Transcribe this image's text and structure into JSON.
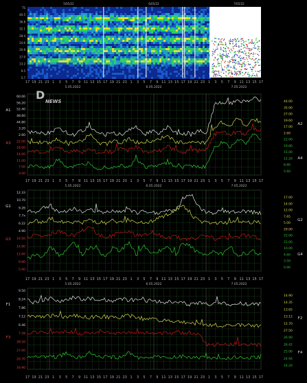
{
  "watermark": {
    "letter": "D",
    "word": "NEWS"
  },
  "spectrogram": {
    "type": "heatmap",
    "top_dates": [
      "5/05/22",
      "6/05/22",
      "7/05/22"
    ],
    "y_ticks": [
      "TS",
      "40.5",
      "36.8",
      "32.1",
      "28.4",
      "24.6",
      "20.8",
      "17.0",
      "13.2",
      "9.5",
      "5.7"
    ],
    "dates": [
      "5.05.2022",
      "6.05.2022",
      "7.05.2022"
    ]
  },
  "panel1": {
    "dates": [
      "5.05.2022",
      "6.05.2022",
      "7.05.2022"
    ],
    "left_ticks": [
      "60.00",
      "56.20",
      "52.40",
      "48.60",
      "44.80",
      "3.20",
      "2.60",
      "22.00",
      "18.00",
      "14.00",
      "11.00",
      "7.00",
      "3.00"
    ],
    "right_ticks": [
      "44.00",
      "35.00",
      "27.00",
      "19.60",
      "17.00",
      "2.60",
      "22.00",
      "19.80",
      "15.00",
      "12.20",
      "8.80",
      "5.60"
    ],
    "left_labels": [
      "A1",
      "A3"
    ],
    "right_labels": [
      "A2",
      "A4"
    ]
  },
  "panel2": {
    "dates": [
      "5.05.2022",
      "6.05.2022",
      "7.05.2022"
    ],
    "left_ticks": [
      "12.33",
      "10.70",
      "9.26",
      "7.7x",
      "6.22",
      "4.90",
      "19.50",
      "14.80",
      "12.60",
      "9.90",
      "5.90"
    ],
    "right_ticks": [
      "17.00",
      "14.00",
      "12.00",
      "7.65",
      "5.00",
      "29.00",
      "25.00",
      "21.00",
      "10.00",
      "4.60",
      "3.50",
      "0.90"
    ],
    "left_labels": [
      "G1",
      "G3"
    ],
    "right_labels": [
      "G2",
      "G4"
    ]
  },
  "panel3": {
    "dates": [
      "5.05.2022",
      "6.05.2022",
      "7.05.2022"
    ],
    "left_ticks": [
      "9.50",
      "8.24",
      "7.86",
      "7.12",
      "6.46",
      "7.28",
      "28.50",
      "27.00",
      "20.70",
      "16.90"
    ],
    "right_ticks": [
      "14.90",
      "14.35",
      "13.65",
      "13.12",
      "12.70",
      "27.50",
      "26.90",
      "26.42",
      "25.06",
      "24.94",
      "24.20"
    ],
    "left_labels": [
      "F1",
      "F3"
    ],
    "right_labels": [
      "F2",
      "F4"
    ]
  },
  "hour_axis": [
    "17",
    "19",
    "21",
    "23",
    "1",
    "3",
    "5",
    "7",
    "9",
    "11",
    "13",
    "15",
    "17",
    "19",
    "21",
    "23",
    "1",
    "3",
    "5",
    "7",
    "9",
    "11",
    "13",
    "15",
    "17",
    "19",
    "21",
    "23",
    "1",
    "3",
    "5",
    "7",
    "9",
    "11",
    "13",
    "15",
    "17"
  ],
  "colors": {
    "white": "#e8e8e8",
    "yellow": "#d8d850",
    "red": "#c81818",
    "green": "#30c830",
    "grid": "#1f5f1f"
  },
  "chart_data": [
    {
      "type": "heatmap",
      "title": "",
      "x_dates": [
        "5.05.2022",
        "6.05.2022",
        "7.05.2022"
      ]
    },
    {
      "type": "line",
      "series": [
        {
          "color": "white",
          "values": [
            0.52,
            0.55,
            0.5,
            0.53,
            0.6,
            0.52,
            0.5,
            0.55,
            0.6,
            0.5,
            0.5,
            0.52,
            0.5,
            0.55,
            0.6,
            0.5,
            0.55,
            0.52,
            0.6,
            0.52,
            0.5,
            0.5,
            0.55,
            0.52,
            0.85,
            0.9,
            0.88,
            0.92,
            0.9,
            0.95,
            0.93
          ]
        },
        {
          "color": "yellow",
          "values": [
            0.4,
            0.38,
            0.42,
            0.4,
            0.45,
            0.38,
            0.4,
            0.42,
            0.5,
            0.4,
            0.38,
            0.42,
            0.4,
            0.45,
            0.4,
            0.4,
            0.42,
            0.44,
            0.5,
            0.4,
            0.4,
            0.42,
            0.4,
            0.4,
            0.6,
            0.65,
            0.6,
            0.7,
            0.6,
            0.7,
            0.65
          ]
        },
        {
          "color": "red",
          "values": [
            0.28,
            0.3,
            0.26,
            0.3,
            0.35,
            0.28,
            0.3,
            0.28,
            0.32,
            0.28,
            0.3,
            0.28,
            0.32,
            0.3,
            0.35,
            0.28,
            0.3,
            0.3,
            0.35,
            0.3,
            0.28,
            0.3,
            0.3,
            0.32,
            0.5,
            0.55,
            0.5,
            0.55,
            0.5,
            0.58,
            0.55
          ]
        },
        {
          "color": "green",
          "values": [
            0.1,
            0.12,
            0.08,
            0.1,
            0.2,
            0.1,
            0.1,
            0.12,
            0.15,
            0.08,
            0.1,
            0.1,
            0.12,
            0.1,
            0.2,
            0.1,
            0.1,
            0.12,
            0.15,
            0.1,
            0.1,
            0.12,
            0.1,
            0.1,
            0.35,
            0.4,
            0.35,
            0.45,
            0.38,
            0.5,
            0.45
          ]
        }
      ]
    },
    {
      "type": "line",
      "series": [
        {
          "color": "white",
          "values": [
            0.75,
            0.72,
            0.78,
            0.8,
            0.72,
            0.75,
            0.78,
            0.72,
            0.76,
            0.74,
            0.72,
            0.75,
            0.74,
            0.76,
            0.72,
            0.74,
            0.73,
            0.72,
            0.76,
            0.74,
            0.9,
            0.95,
            0.8,
            0.72,
            0.72,
            0.74,
            0.73,
            0.72,
            0.74,
            0.73,
            0.72
          ]
        },
        {
          "color": "yellow",
          "values": [
            0.6,
            0.62,
            0.6,
            0.65,
            0.6,
            0.62,
            0.6,
            0.6,
            0.63,
            0.6,
            0.6,
            0.62,
            0.6,
            0.64,
            0.6,
            0.6,
            0.62,
            0.66,
            0.7,
            0.75,
            0.8,
            0.7,
            0.62,
            0.6,
            0.58,
            0.6,
            0.6,
            0.62,
            0.6,
            0.6,
            0.6
          ]
        },
        {
          "color": "red",
          "values": [
            0.42,
            0.44,
            0.42,
            0.46,
            0.5,
            0.45,
            0.44,
            0.5,
            0.55,
            0.45,
            0.42,
            0.44,
            0.5,
            0.48,
            0.44,
            0.45,
            0.48,
            0.44,
            0.42,
            0.42,
            0.4,
            0.4,
            0.42,
            0.44,
            0.4,
            0.42,
            0.4,
            0.42,
            0.44,
            0.42,
            0.4
          ]
        },
        {
          "color": "green",
          "values": [
            0.15,
            0.2,
            0.18,
            0.3,
            0.2,
            0.25,
            0.35,
            0.2,
            0.3,
            0.25,
            0.18,
            0.3,
            0.25,
            0.35,
            0.2,
            0.3,
            0.22,
            0.25,
            0.3,
            0.2,
            0.35,
            0.3,
            0.22,
            0.2,
            0.25,
            0.2,
            0.3,
            0.2,
            0.22,
            0.25,
            0.2
          ]
        }
      ]
    },
    {
      "type": "line",
      "series": [
        {
          "color": "white",
          "values": [
            0.85,
            0.82,
            0.86,
            0.88,
            0.84,
            0.85,
            0.9,
            0.86,
            0.88,
            0.85,
            0.86,
            0.84,
            0.88,
            0.85,
            0.86,
            0.84,
            0.85,
            0.84,
            0.83,
            0.82,
            0.82,
            0.8,
            0.82,
            0.8,
            0.8,
            0.82,
            0.8,
            0.82,
            0.8,
            0.82,
            0.8
          ]
        },
        {
          "color": "yellow",
          "values": [
            0.65,
            0.66,
            0.64,
            0.66,
            0.65,
            0.64,
            0.66,
            0.65,
            0.64,
            0.66,
            0.64,
            0.65,
            0.64,
            0.66,
            0.64,
            0.62,
            0.62,
            0.6,
            0.6,
            0.58,
            0.58,
            0.56,
            0.56,
            0.55,
            0.55,
            0.54,
            0.55,
            0.54,
            0.55,
            0.54,
            0.53
          ]
        },
        {
          "color": "red",
          "values": [
            0.45,
            0.46,
            0.45,
            0.46,
            0.45,
            0.46,
            0.45,
            0.44,
            0.46,
            0.45,
            0.46,
            0.45,
            0.44,
            0.45,
            0.46,
            0.45,
            0.44,
            0.45,
            0.44,
            0.45,
            0.44,
            0.45,
            0.44,
            0.3,
            0.3,
            0.31,
            0.3,
            0.32,
            0.31,
            0.3,
            0.3
          ]
        },
        {
          "color": "green",
          "values": [
            0.15,
            0.16,
            0.15,
            0.16,
            0.15,
            0.2,
            0.16,
            0.14,
            0.2,
            0.15,
            0.16,
            0.15,
            0.14,
            0.2,
            0.15,
            0.14,
            0.16,
            0.15,
            0.14,
            0.15,
            0.16,
            0.15,
            0.14,
            0.15,
            0.14,
            0.15,
            0.14,
            0.15,
            0.14,
            0.15,
            0.14
          ]
        }
      ]
    }
  ]
}
